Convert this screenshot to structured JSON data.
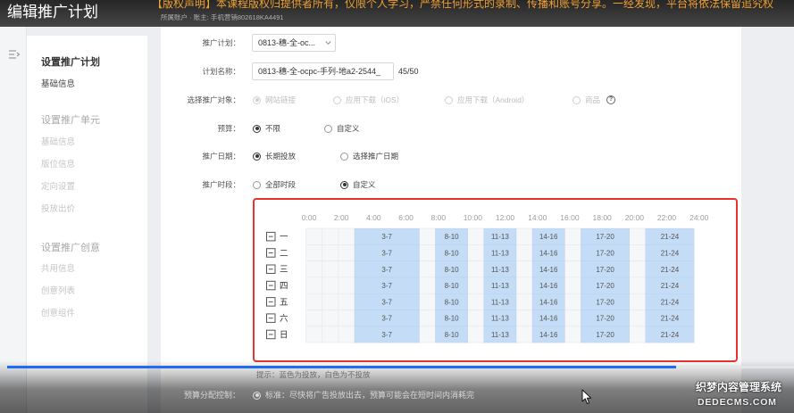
{
  "header": {
    "title": "编辑推广计划",
    "notice": "【版权声明】本课程版权归提供者所有，仅限个人学习，严禁任何形式的录制、传播和账号分享。一经发现，平台将依法保留追究权",
    "subline": "所属账户 · 账主: 手机营销802618KA4491"
  },
  "sidebar": {
    "sections": [
      {
        "title": "设置推广计划",
        "items": [
          "基础信息"
        ]
      },
      {
        "title": "设置推广单元",
        "items": [
          "基础信息",
          "版位信息",
          "定向设置",
          "投放出价"
        ]
      },
      {
        "title": "设置推广创意",
        "items": [
          "共用信息",
          "创意列表",
          "创意组件"
        ]
      }
    ]
  },
  "form": {
    "plan": {
      "label": "推广计划：",
      "value": "0813-穗-全-oc..."
    },
    "name": {
      "label": "计划名称：",
      "value": "0813-穗-全-ocpc-手列-地a2-2544_",
      "counter": "45/50"
    },
    "target": {
      "label": "选择推广对象：",
      "options": [
        "网站链接",
        "应用下载（iOS）",
        "应用下载（Android）",
        "商品"
      ],
      "selected_index": 0
    },
    "budget": {
      "label": "预算：",
      "options": [
        "不限",
        "自定义"
      ],
      "selected_index": 0
    },
    "date": {
      "label": "推广日期：",
      "options": [
        "长期投放",
        "选择推广日期"
      ],
      "selected_index": 0
    },
    "period": {
      "label": "推广时段：",
      "options": [
        "全部时段",
        "自定义"
      ],
      "selected_index": 1
    },
    "budget_control": {
      "label": "预算分配控制：",
      "options": [
        "标准：尽快将广告投放出去，预算可能会在短时间内消耗完"
      ],
      "selected_index": 0
    }
  },
  "schedule": {
    "hour_labels": [
      "0:00",
      "2:00",
      "4:00",
      "6:00",
      "8:00",
      "10:00",
      "12:00",
      "14:00",
      "16:00",
      "18:00",
      "20:00",
      "22:00",
      "24:00"
    ],
    "days": [
      "一",
      "二",
      "三",
      "四",
      "五",
      "六",
      "日"
    ],
    "blocks": [
      {
        "start": 3,
        "end": 7,
        "label": "3-7"
      },
      {
        "start": 8,
        "end": 10,
        "label": "8-10"
      },
      {
        "start": 11,
        "end": 13,
        "label": "11-13"
      },
      {
        "start": 14,
        "end": 16,
        "label": "14-16"
      },
      {
        "start": 17,
        "end": 20,
        "label": "17-20"
      },
      {
        "start": 21,
        "end": 24,
        "label": "21-24"
      }
    ],
    "hint": "提示：蓝色为投放，白色为不投放"
  },
  "player": {
    "progress": 0.85
  },
  "watermark": {
    "line1": "织梦内容管理系统",
    "line2": "DEDECMS.COM"
  },
  "icons": {
    "expand": "expand-menu-icon",
    "select_arrow": "chevron-down-icon",
    "help": "help-icon",
    "day_toggle": "minus-square-icon",
    "pointer": "mouse-pointer-icon"
  },
  "colors": {
    "header_bg": "#3a3a3a",
    "notice": "#f0a030",
    "schedule_on": "#c4dcf5",
    "schedule_off": "#f6f7f9",
    "annotation": "#e8322e",
    "progress": "#1f6cf2"
  }
}
